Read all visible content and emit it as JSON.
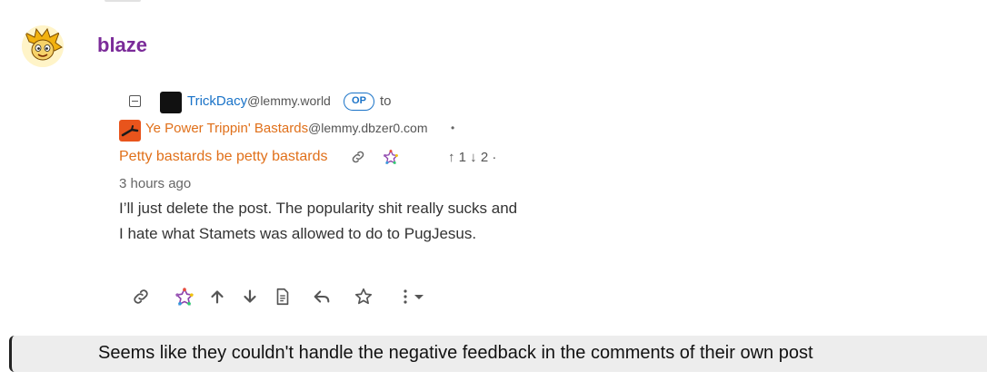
{
  "comment": {
    "username": "blaze"
  },
  "quoted": {
    "author_name": "TrickDacy",
    "author_instance": "@lemmy.world",
    "op_badge": "OP",
    "to_label": "to",
    "community_name": "Ye Power Trippin' Bastards",
    "community_instance": "@lemmy.dbzer0.com",
    "separator": "•",
    "post_title": "Petty bastards be petty bastards",
    "votes": "↑ 1 ↓ 2 ·",
    "timestamp": "3 hours ago",
    "body": "I’ll just delete the post. The popularity shit really sucks and I hate what Stamets was allowed to do to PugJesus."
  },
  "action_icons": [
    "link-icon",
    "fediverse-icon",
    "upvote-icon",
    "downvote-icon",
    "view-source-icon",
    "reply-icon",
    "star-icon",
    "more-options-icon"
  ],
  "reply": {
    "text": "Seems like they couldn't handle the negative feedback in the comments of their own post"
  },
  "colors": {
    "username": "#7b2b99",
    "author": "#1a73c8",
    "community": "#e0701a",
    "reply_bar": "#ededed"
  }
}
